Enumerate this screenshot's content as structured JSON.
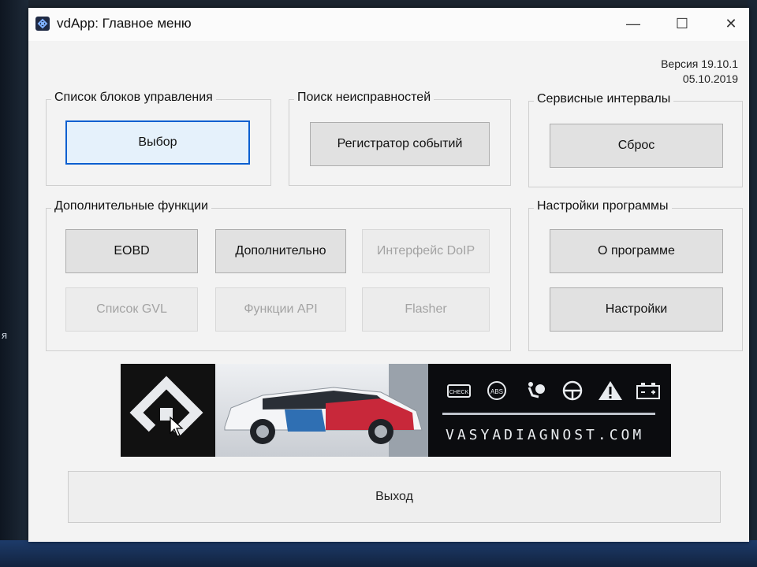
{
  "window": {
    "title": "vdApp:  Главное меню",
    "controls": {
      "minimize": "—",
      "maximize": "☐",
      "close": "✕"
    }
  },
  "version": {
    "label": "Версия 19.10.1",
    "date": "05.10.2019"
  },
  "groups": {
    "control_units": {
      "title": "Список блоков управления",
      "select_button": "Выбор"
    },
    "troubleshooting": {
      "title": "Поиск неисправностей",
      "event_recorder_button": "Регистратор событий"
    },
    "service_intervals": {
      "title": "Сервисные интервалы",
      "reset_button": "Сброс"
    },
    "additional": {
      "title": "Дополнительные функции",
      "buttons": {
        "eobd": "EOBD",
        "extra": "Дополнительно",
        "doip": "Интерфейс DoIP",
        "gvl": "Список GVL",
        "api": "Функции API",
        "flasher": "Flasher"
      }
    },
    "settings": {
      "title": "Настройки программы",
      "about_button": "О программе",
      "settings_button": "Настройки"
    }
  },
  "banner": {
    "website": "VASYADIAGNOST.COM",
    "icons": [
      "check-engine-icon",
      "abs-icon",
      "airbag-icon",
      "steering-icon",
      "warning-triangle-icon",
      "battery-icon"
    ],
    "check_label": "CHECK",
    "abs_label": "ABS"
  },
  "exit_button": "Выход",
  "desktop": {
    "side_text": "я"
  },
  "colors": {
    "focus_border": "#0b5fd0",
    "disabled_text": "#a3a3a3",
    "car_blue": "#2f6fb3",
    "car_red": "#c8283a"
  }
}
